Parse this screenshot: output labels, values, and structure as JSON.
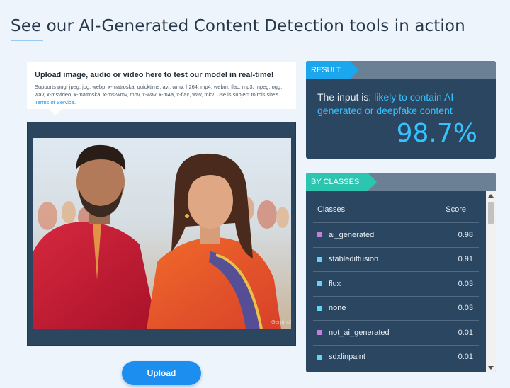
{
  "page": {
    "headline": "See our AI-Generated Content Detection tools in action"
  },
  "upload_info": {
    "title": "Upload image, audio or video here to test our model in real-time!",
    "supported_text": "Supports png, jpeg, jpg, webp, x-matroska, quicktime, avi, wmv, h264, mp4, webm, flac, mp3, mpeg, ogg, wav, x-msvideo, x-matroska, x-ms-wmv, mov, x-wav, x-m4a, x-flac, wav, mkv. Use is subject to this site's",
    "tos_link": "Terms of Service",
    "tos_suffix": "."
  },
  "preview": {
    "watermark": "GeminiAI"
  },
  "upload_button": {
    "label": "Upload"
  },
  "result": {
    "tag": "RESULT",
    "prefix": "The input is: ",
    "verdict": "likely to contain AI-generated or deepfake content",
    "score": "98.7%"
  },
  "classes": {
    "tag": "BY CLASSES",
    "col_class": "Classes",
    "col_score": "Score",
    "rows": [
      {
        "name": "ai_generated",
        "score": "0.98",
        "color": "#c77ddc"
      },
      {
        "name": "stablediffusion",
        "score": "0.91",
        "color": "#5fd6f5"
      },
      {
        "name": "flux",
        "score": "0.03",
        "color": "#5fd6f5"
      },
      {
        "name": "none",
        "score": "0.03",
        "color": "#5fd6f5"
      },
      {
        "name": "not_ai_generated",
        "score": "0.01",
        "color": "#c77ddc"
      },
      {
        "name": "sdxlinpaint",
        "score": "0.01",
        "color": "#5fd6f5"
      }
    ]
  },
  "colors": {
    "accent_blue": "#1b8ef0",
    "result_tag": "#1aa7ee",
    "classes_tag": "#2cc6b0",
    "card_bg": "#2b4660",
    "highlight": "#37c2ff"
  }
}
